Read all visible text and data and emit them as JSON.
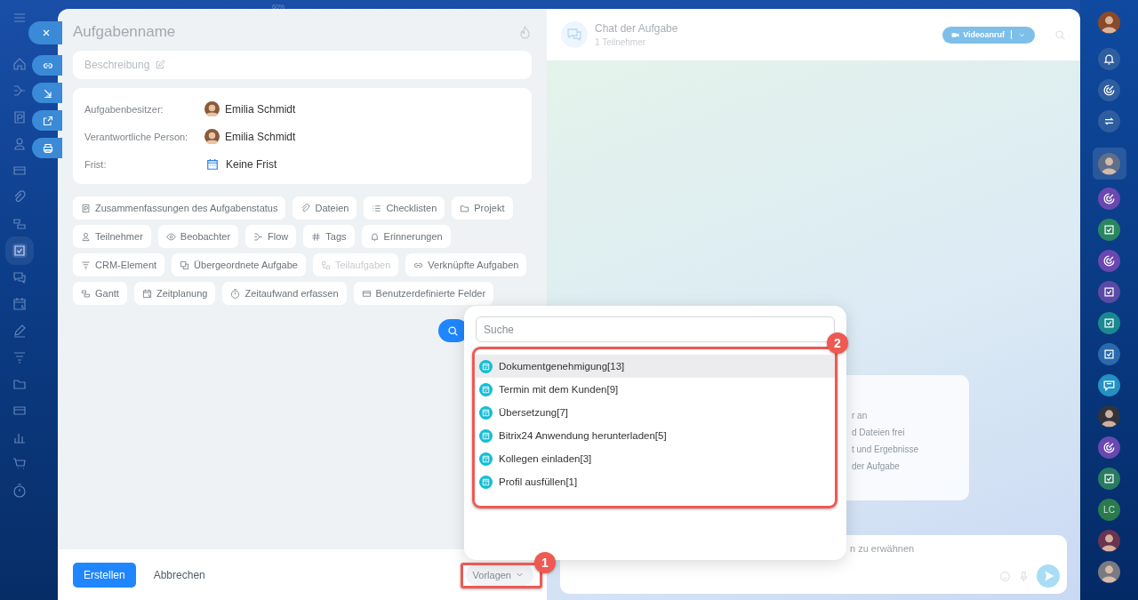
{
  "top_bar": {
    "zoom": "60%"
  },
  "left_nav": [
    {
      "kind": "home",
      "selected": false
    },
    {
      "kind": "flow",
      "selected": false
    },
    {
      "kind": "summary",
      "selected": false
    },
    {
      "kind": "person",
      "selected": false
    },
    {
      "kind": "field",
      "selected": false
    },
    {
      "kind": "file",
      "selected": false
    },
    {
      "kind": "gantt",
      "selected": false
    },
    {
      "kind": "check",
      "selected": true
    },
    {
      "kind": "chat",
      "selected": false
    },
    {
      "kind": "plan",
      "selected": false
    },
    {
      "kind": "pen",
      "selected": false
    },
    {
      "kind": "crm",
      "selected": false
    },
    {
      "kind": "folder",
      "selected": false
    },
    {
      "kind": "field",
      "selected": false
    },
    {
      "kind": "bars",
      "selected": false
    },
    {
      "kind": "cart",
      "selected": false
    },
    {
      "kind": "timer",
      "selected": false
    }
  ],
  "task": {
    "title": "Aufgabenname",
    "description_placeholder": "Beschreibung",
    "fields": [
      {
        "label": "Aufgabenbesitzer:",
        "value": "Emilia Schmidt",
        "kind": "person"
      },
      {
        "label": "Verantwortliche Person:",
        "value": "Emilia Schmidt",
        "kind": "person"
      },
      {
        "label": "Frist:",
        "value": "Keine Frist",
        "kind": "date"
      }
    ],
    "chips": [
      {
        "label": "Zusammenfassungen des Aufgabenstatus",
        "kind": "summary",
        "disabled": false
      },
      {
        "label": "Dateien",
        "kind": "file",
        "disabled": false
      },
      {
        "label": "Checklisten",
        "kind": "checklist",
        "disabled": false
      },
      {
        "label": "Projekt",
        "kind": "folder",
        "disabled": false
      },
      {
        "label": "Teilnehmer",
        "kind": "person",
        "disabled": false
      },
      {
        "label": "Beobachter",
        "kind": "eye",
        "disabled": false
      },
      {
        "label": "Flow",
        "kind": "flow",
        "disabled": false
      },
      {
        "label": "Tags",
        "kind": "hash",
        "disabled": false
      },
      {
        "label": "Erinnerungen",
        "kind": "bell",
        "disabled": false
      },
      {
        "label": "CRM-Element",
        "kind": "crm",
        "disabled": false
      },
      {
        "label": "Übergeordnete Aufgabe",
        "kind": "parent",
        "disabled": false
      },
      {
        "label": "Teilaufgaben",
        "kind": "subtask",
        "disabled": true
      },
      {
        "label": "Verknüpfte Aufgaben",
        "kind": "link",
        "disabled": false
      },
      {
        "label": "Gantt",
        "kind": "gantt",
        "disabled": false
      },
      {
        "label": "Zeitplanung",
        "kind": "plan",
        "disabled": false
      },
      {
        "label": "Zeitaufwand erfassen",
        "kind": "timer",
        "disabled": false
      },
      {
        "label": "Benutzerdefinierte Felder",
        "kind": "field",
        "disabled": false
      }
    ],
    "footer": {
      "create": "Erstellen",
      "cancel": "Abbrechen",
      "templates": "Vorlagen"
    }
  },
  "chat": {
    "title": "Chat der Aufgabe",
    "subtitle": "1 Teilnehmer",
    "video_button": "Videoanruf",
    "card_lines": [
      "r an",
      "d Dateien frei",
      "t und Ergebnisse",
      "der Aufgabe"
    ],
    "input_placeholder": "n zu erwähnen"
  },
  "templates_menu": {
    "search_placeholder": "Suche",
    "items": [
      {
        "label": "Dokumentgenehmigung[13]",
        "selected": true
      },
      {
        "label": "Termin mit dem Kunden[9]",
        "selected": false
      },
      {
        "label": "Übersetzung[7]",
        "selected": false
      },
      {
        "label": "Bitrix24 Anwendung herunterladen[5]",
        "selected": false
      },
      {
        "label": "Kollegen einladen[3]",
        "selected": false
      },
      {
        "label": "Profil ausfüllen[1]",
        "selected": false
      }
    ]
  },
  "callouts": [
    "1",
    "2"
  ],
  "right_bar": [
    {
      "kind": "avatar",
      "color": "#8a4a2a"
    },
    {
      "kind": "bell",
      "color": "#2f5ea0"
    },
    {
      "kind": "target",
      "color": "#2f5ea0"
    },
    {
      "kind": "swap",
      "color": "#2f5ea0"
    },
    {
      "kind": "avatar",
      "color": "#5f6f8a"
    },
    {
      "kind": "target",
      "color": "#6a48b0"
    },
    {
      "kind": "task",
      "color": "#2a8660"
    },
    {
      "kind": "target",
      "color": "#6a48b0"
    },
    {
      "kind": "task",
      "color": "#5a4aa6"
    },
    {
      "kind": "task",
      "color": "#1a8890"
    },
    {
      "kind": "task",
      "color": "#2a6aac"
    },
    {
      "kind": "bubble",
      "color": "#2590c4"
    },
    {
      "kind": "avatar",
      "color": "#33333c"
    },
    {
      "kind": "target",
      "color": "#6a48b0"
    },
    {
      "kind": "task",
      "color": "#2a7a60"
    },
    {
      "kind": "initials",
      "color": "#2a7a4c",
      "text": "LC"
    },
    {
      "kind": "avatar",
      "color": "#6a3450"
    },
    {
      "kind": "avatar",
      "color": "#7a7a80"
    }
  ]
}
